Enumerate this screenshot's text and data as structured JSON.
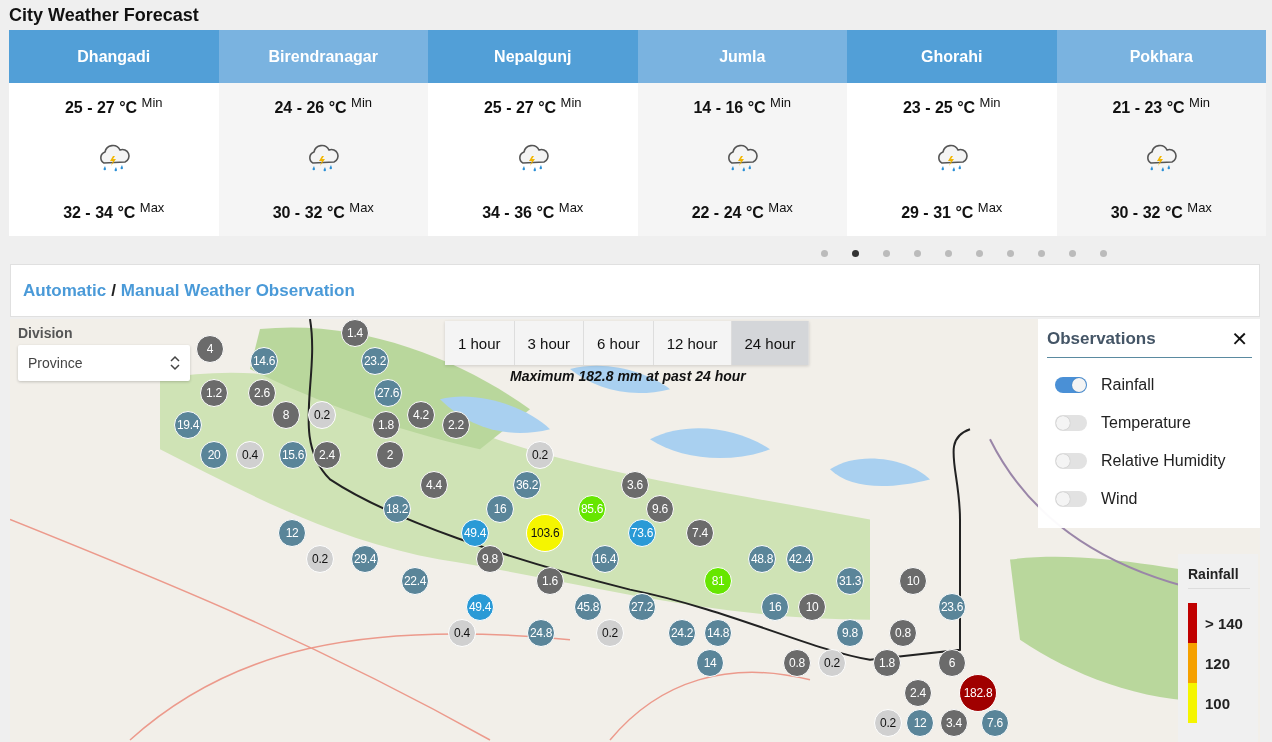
{
  "title": "City Weather Forecast",
  "cities": [
    {
      "name": "Dhangadi",
      "min": "25 - 27 °C",
      "min_label": "Min",
      "max": "32 - 34 °C",
      "max_label": "Max"
    },
    {
      "name": "Birendranagar",
      "min": "24 - 26 °C",
      "min_label": "Min",
      "max": "30 - 32 °C",
      "max_label": "Max"
    },
    {
      "name": "Nepalgunj",
      "min": "25 - 27 °C",
      "min_label": "Min",
      "max": "34 - 36 °C",
      "max_label": "Max"
    },
    {
      "name": "Jumla",
      "min": "14 - 16 °C",
      "min_label": "Min",
      "max": "22 - 24 °C",
      "max_label": "Max"
    },
    {
      "name": "Ghorahi",
      "min": "23 - 25 °C",
      "min_label": "Min",
      "max": "29 - 31 °C",
      "max_label": "Max"
    },
    {
      "name": "Pokhara",
      "min": "21 - 23 °C",
      "min_label": "Min",
      "max": "30 - 32 °C",
      "max_label": "Max"
    }
  ],
  "pager": [
    {
      "selected": false
    },
    {
      "selected": true
    },
    {
      "selected": false
    },
    {
      "selected": false
    },
    {
      "selected": false
    },
    {
      "selected": false
    },
    {
      "selected": false
    },
    {
      "selected": false
    },
    {
      "selected": false
    },
    {
      "selected": false
    }
  ],
  "observation_header": {
    "automatic": "Automatic",
    "separator": "/",
    "manual": "Manual Weather Observation"
  },
  "division": {
    "label": "Division",
    "value": "Province"
  },
  "time_tabs": [
    {
      "label": "1 hour",
      "selected": false
    },
    {
      "label": "3 hour",
      "selected": false
    },
    {
      "label": "6 hour",
      "selected": false
    },
    {
      "label": "12 hour",
      "selected": false
    },
    {
      "label": "24 hour",
      "selected": true
    }
  ],
  "caption": "Maximum 182.8 mm at past 24 hour",
  "observations": {
    "title": "Observations",
    "close": "✕",
    "items": [
      {
        "label": "Rainfall",
        "on": true
      },
      {
        "label": "Temperature",
        "on": false
      },
      {
        "label": "Relative Humidity",
        "on": false
      },
      {
        "label": "Wind",
        "on": false
      }
    ]
  },
  "legend": {
    "title": "Rainfall",
    "items": [
      {
        "label": "> 140",
        "color": "#c00000"
      },
      {
        "label": "120",
        "color": "#f5a000"
      },
      {
        "label": "100",
        "color": "#f5f500"
      }
    ]
  },
  "markers": [
    {
      "value": "1.4",
      "color": "#6b6b6b"
    },
    {
      "value": "4",
      "color": "#6b6b6b"
    },
    {
      "value": "14.6",
      "color": "#5a8599"
    },
    {
      "value": "23.2",
      "color": "#5a8599"
    },
    {
      "value": "1.2",
      "color": "#6b6b6b"
    },
    {
      "value": "2.6",
      "color": "#6b6b6b"
    },
    {
      "value": "27.6",
      "color": "#5a8599"
    },
    {
      "value": "8",
      "color": "#6b6b6b"
    },
    {
      "value": "0.2",
      "color": "#d0d0d0"
    },
    {
      "value": "4.2",
      "color": "#6b6b6b"
    },
    {
      "value": "19.4",
      "color": "#5a8599"
    },
    {
      "value": "1.8",
      "color": "#6b6b6b"
    },
    {
      "value": "2.2",
      "color": "#6b6b6b"
    },
    {
      "value": "20",
      "color": "#5a8599"
    },
    {
      "value": "0.4",
      "color": "#d0d0d0"
    },
    {
      "value": "15.6",
      "color": "#5a8599"
    },
    {
      "value": "2.4",
      "color": "#6b6b6b"
    },
    {
      "value": "2",
      "color": "#6b6b6b"
    },
    {
      "value": "0.2",
      "color": "#d0d0d0"
    },
    {
      "value": "4.4",
      "color": "#6b6b6b"
    },
    {
      "value": "36.2",
      "color": "#5a8599"
    },
    {
      "value": "3.6",
      "color": "#6b6b6b"
    },
    {
      "value": "18.2",
      "color": "#5a8599"
    },
    {
      "value": "16",
      "color": "#5a8599"
    },
    {
      "value": "85.6",
      "color": "#66e600"
    },
    {
      "value": "9.6",
      "color": "#6b6b6b"
    },
    {
      "value": "12",
      "color": "#5a8599"
    },
    {
      "value": "49.4",
      "color": "#2a9ad6"
    },
    {
      "value": "103.6",
      "color": "#f5f500"
    },
    {
      "value": "73.6",
      "color": "#2a9ad6"
    },
    {
      "value": "7.4",
      "color": "#6b6b6b"
    },
    {
      "value": "0.2",
      "color": "#d0d0d0"
    },
    {
      "value": "29.4",
      "color": "#5a8599"
    },
    {
      "value": "9.8",
      "color": "#6b6b6b"
    },
    {
      "value": "16.4",
      "color": "#5a8599"
    },
    {
      "value": "48.8",
      "color": "#5a8599"
    },
    {
      "value": "42.4",
      "color": "#5a8599"
    },
    {
      "value": "22.4",
      "color": "#5a8599"
    },
    {
      "value": "1.6",
      "color": "#6b6b6b"
    },
    {
      "value": "81",
      "color": "#66e600"
    },
    {
      "value": "31.3",
      "color": "#5a8599"
    },
    {
      "value": "10",
      "color": "#6b6b6b"
    },
    {
      "value": "49.4",
      "color": "#2a9ad6"
    },
    {
      "value": "45.8",
      "color": "#5a8599"
    },
    {
      "value": "27.2",
      "color": "#5a8599"
    },
    {
      "value": "16",
      "color": "#5a8599"
    },
    {
      "value": "10",
      "color": "#6b6b6b"
    },
    {
      "value": "23.6",
      "color": "#5a8599"
    },
    {
      "value": "0.4",
      "color": "#d0d0d0"
    },
    {
      "value": "24.8",
      "color": "#5a8599"
    },
    {
      "value": "0.2",
      "color": "#d0d0d0"
    },
    {
      "value": "24.2",
      "color": "#5a8599"
    },
    {
      "value": "14.8",
      "color": "#5a8599"
    },
    {
      "value": "9.8",
      "color": "#5a8599"
    },
    {
      "value": "0.8",
      "color": "#6b6b6b"
    },
    {
      "value": "14",
      "color": "#5a8599"
    },
    {
      "value": "0.8",
      "color": "#6b6b6b"
    },
    {
      "value": "0.2",
      "color": "#d0d0d0"
    },
    {
      "value": "1.8",
      "color": "#6b6b6b"
    },
    {
      "value": "6",
      "color": "#6b6b6b"
    },
    {
      "value": "2.4",
      "color": "#6b6b6b"
    },
    {
      "value": "182.8",
      "color": "#a00000"
    },
    {
      "value": "0.2",
      "color": "#d0d0d0"
    },
    {
      "value": "12",
      "color": "#5a8599"
    },
    {
      "value": "3.4",
      "color": "#6b6b6b"
    },
    {
      "value": "7.6",
      "color": "#5a8599"
    }
  ]
}
